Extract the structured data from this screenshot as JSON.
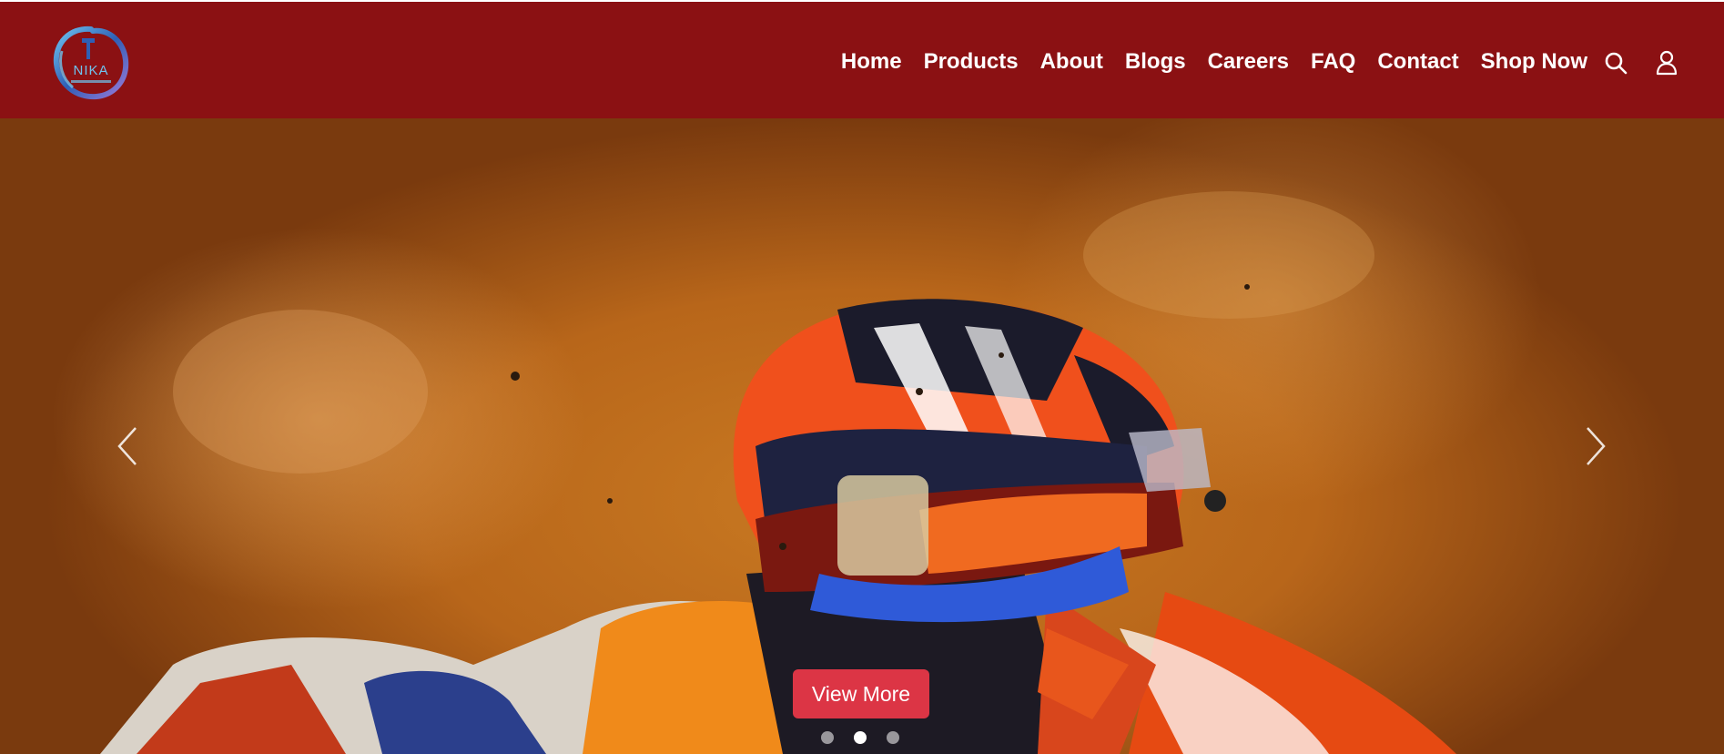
{
  "brand": {
    "logo_text": "NIKA",
    "logo_colors": [
      "#5fb0e8",
      "#2f5fb5",
      "#9a7ad8"
    ]
  },
  "nav": {
    "items": [
      {
        "label": "Home"
      },
      {
        "label": "Products"
      },
      {
        "label": "About"
      },
      {
        "label": "Blogs"
      },
      {
        "label": "Careers"
      },
      {
        "label": "FAQ"
      },
      {
        "label": "Contact"
      },
      {
        "label": "Shop Now"
      }
    ],
    "icons": [
      "search-icon",
      "user-icon"
    ]
  },
  "hero": {
    "image_subject": "motocross rider helmet",
    "cta_label": "View More",
    "arrow_icons": [
      "chevron-left-icon",
      "chevron-right-icon"
    ],
    "slides_count": 3,
    "active_slide": 2
  },
  "colors": {
    "header_bg": "#8b1113",
    "cta_bg": "#dc3545",
    "text_light": "#ffffff"
  }
}
